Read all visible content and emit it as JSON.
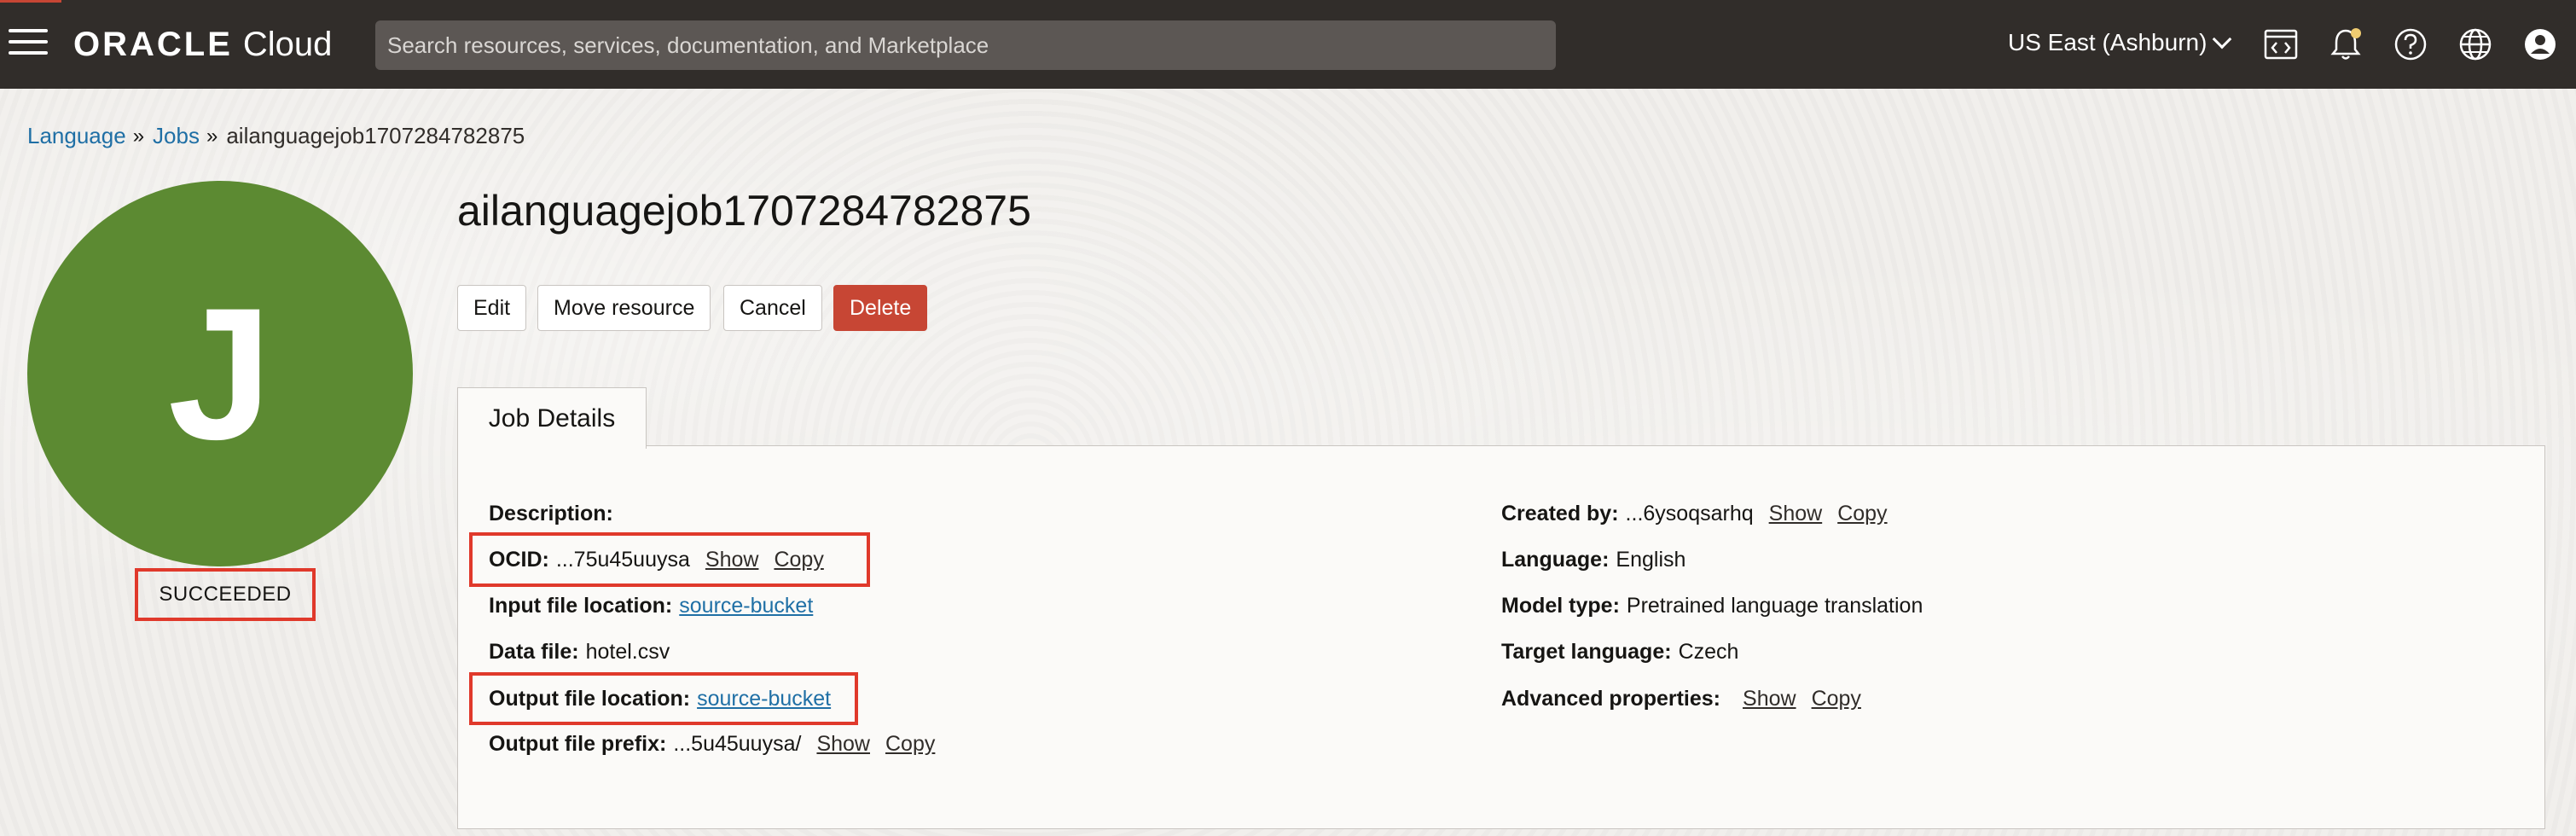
{
  "header": {
    "logo_oracle": "ORACLE",
    "logo_cloud": "Cloud",
    "search_placeholder": "Search resources, services, documentation, and Marketplace",
    "region": "US East (Ashburn)",
    "icons": [
      "code-editor-icon",
      "bell-icon",
      "help-icon",
      "globe-icon",
      "user-icon"
    ],
    "accent_color": "#c74634"
  },
  "breadcrumb": {
    "items": [
      "Language",
      "Jobs"
    ],
    "separator": "»",
    "current": "ailanguagejob1707284782875"
  },
  "avatar": {
    "letter": "J",
    "color": "#5c8a32"
  },
  "status": "SUCCEEDED",
  "page_title": "ailanguagejob1707284782875",
  "actions": {
    "edit": "Edit",
    "move": "Move resource",
    "cancel": "Cancel",
    "delete": "Delete"
  },
  "tab": "Job Details",
  "details_left": {
    "description_label": "Description:",
    "ocid_label": "OCID:",
    "ocid_value": "...75u45uuysa",
    "input_label": "Input file location:",
    "input_value": "source-bucket",
    "data_file_label": "Data file:",
    "data_file_value": "hotel.csv",
    "output_label": "Output file location:",
    "output_value": "source-bucket",
    "prefix_label": "Output file prefix:",
    "prefix_value": "...5u45uuysa/"
  },
  "details_right": {
    "created_label": "Created by:",
    "created_value": "...6ysoqsarhq",
    "language_label": "Language:",
    "language_value": "English",
    "model_label": "Model type:",
    "model_value": "Pretrained language translation",
    "target_label": "Target language:",
    "target_value": "Czech",
    "advanced_label": "Advanced properties:"
  },
  "link_actions": {
    "show": "Show",
    "copy": "Copy"
  }
}
